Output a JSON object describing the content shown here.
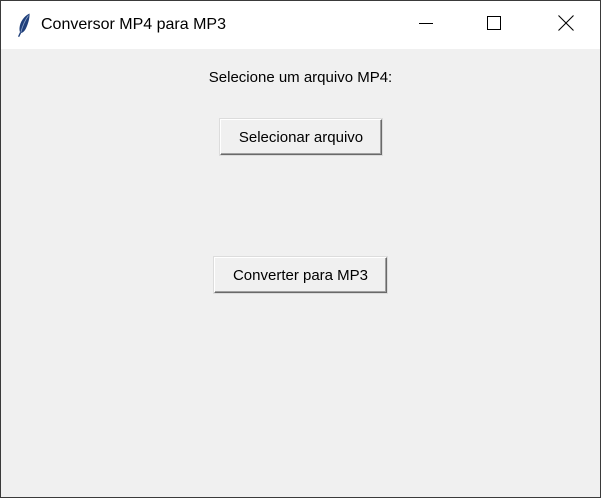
{
  "window": {
    "title": "Conversor MP4 para MP3",
    "icon": "feather-icon"
  },
  "titlebar_buttons": {
    "minimize": "minimize-icon",
    "maximize": "maximize-icon",
    "close": "close-icon"
  },
  "main": {
    "prompt_label": "Selecione um arquivo MP4:",
    "select_button_label": "Selecionar arquivo",
    "convert_button_label": "Converter para MP3"
  },
  "colors": {
    "client_background": "#f0f0f0",
    "titlebar_background": "#ffffff",
    "icon_blue": "#1f3f7a"
  }
}
